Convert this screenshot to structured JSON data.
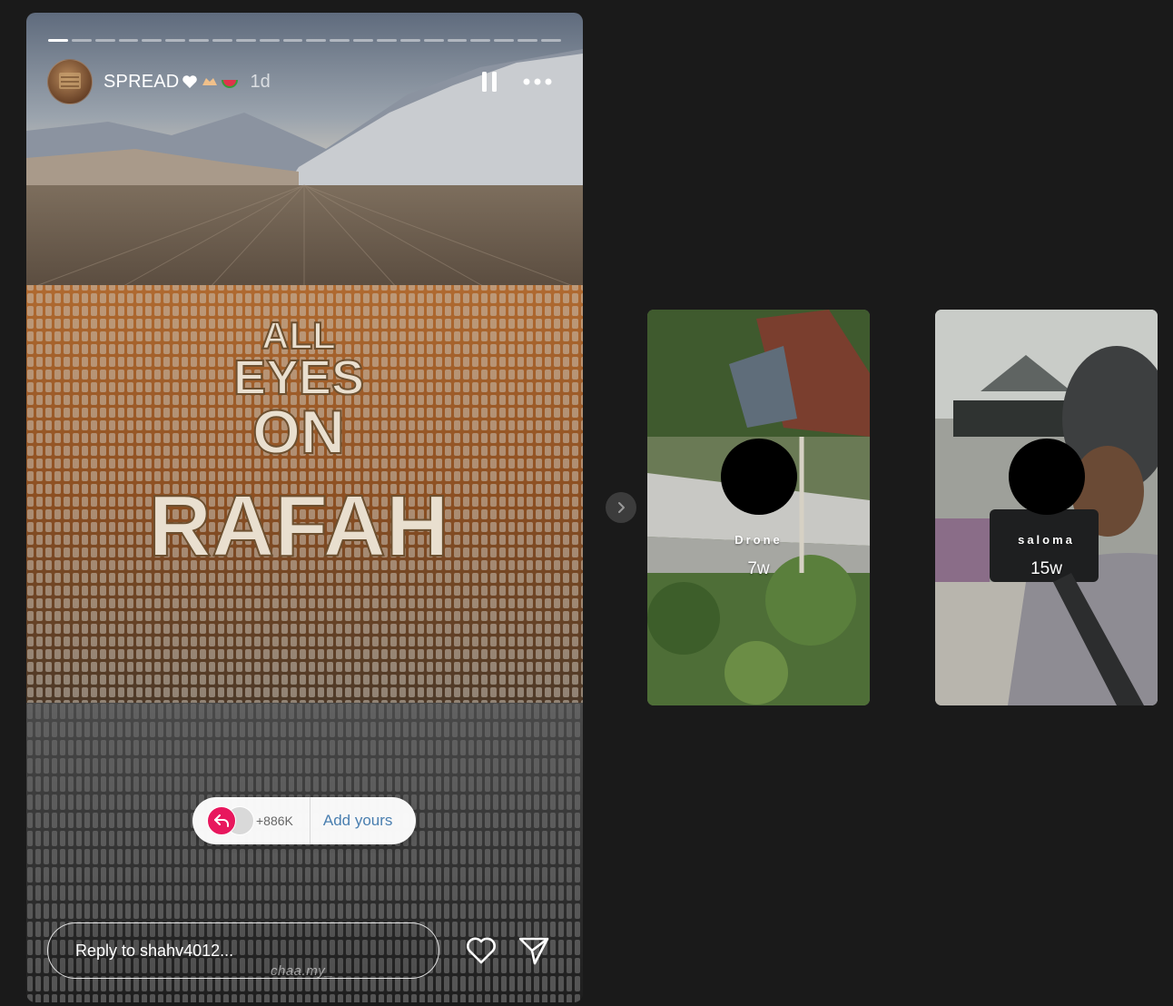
{
  "story": {
    "username": "SPREAD",
    "username_emoji": "🤍🫶🍉",
    "timestamp": "1d",
    "segments": 22,
    "active_segment": 1,
    "image_text_lines": [
      "ALL",
      "EYES",
      "ON",
      "RAFAH"
    ],
    "add_yours": {
      "count": "+886K",
      "label": "Add yours"
    },
    "reply_placeholder": "Reply to shahv4012...",
    "watermark": "chaa.my_"
  },
  "icons": {
    "pause": "pause-icon",
    "more": "more-icon",
    "heart": "heart-icon",
    "share": "send-icon",
    "next": "chevron-right-icon"
  },
  "side_stories": [
    {
      "name": "Drone",
      "age": "7w"
    },
    {
      "name": "saloma",
      "age": "15w"
    }
  ]
}
